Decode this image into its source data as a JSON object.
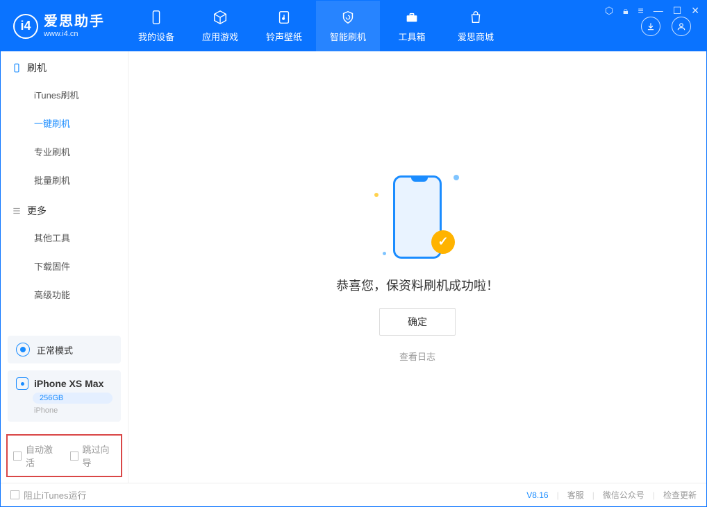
{
  "app": {
    "name": "爱思助手",
    "url": "www.i4.cn"
  },
  "tabs": [
    {
      "label": "我的设备"
    },
    {
      "label": "应用游戏"
    },
    {
      "label": "铃声壁纸"
    },
    {
      "label": "智能刷机"
    },
    {
      "label": "工具箱"
    },
    {
      "label": "爱思商城"
    }
  ],
  "sidebar": {
    "section1_title": "刷机",
    "section1_items": [
      {
        "label": "iTunes刷机"
      },
      {
        "label": "一键刷机"
      },
      {
        "label": "专业刷机"
      },
      {
        "label": "批量刷机"
      }
    ],
    "section2_title": "更多",
    "section2_items": [
      {
        "label": "其他工具"
      },
      {
        "label": "下载固件"
      },
      {
        "label": "高级功能"
      }
    ]
  },
  "mode": {
    "label": "正常模式"
  },
  "device": {
    "name": "iPhone XS Max",
    "capacity": "256GB",
    "type": "iPhone"
  },
  "checks": {
    "auto_activate": "自动激活",
    "skip_guide": "跳过向导"
  },
  "main": {
    "success": "恭喜您，保资料刷机成功啦！",
    "ok": "确定",
    "view_log": "查看日志"
  },
  "footer": {
    "block_itunes": "阻止iTunes运行",
    "version": "V8.16",
    "support": "客服",
    "wechat": "微信公众号",
    "update": "检查更新"
  }
}
